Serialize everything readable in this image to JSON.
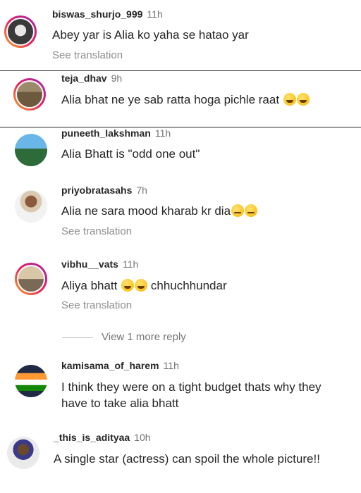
{
  "comments": [
    {
      "username": "biswas_shurjo_999",
      "time": "11h",
      "text": "Abey yar is Alia ko yaha se hatao yar",
      "translate": "See translation"
    },
    {
      "username": "teja_dhav",
      "time": "9h",
      "text": "Alia bhat ne ye sab ratta hoga pichle raat",
      "translate": ""
    },
    {
      "username": "puneeth_lakshman",
      "time": "11h",
      "text": "Alia Bhatt is \"odd one out\"",
      "translate": ""
    },
    {
      "username": "priyobratasahs",
      "time": "7h",
      "text": "Alia ne sara mood kharab kr dia",
      "translate": "See translation"
    },
    {
      "username": "vibhu__vats",
      "time": "11h",
      "text_a": "Aliya bhatt",
      "text_b": "chhuchhundar",
      "translate": "See translation"
    },
    {
      "username": "kamisama_of_harem",
      "time": "11h",
      "text": "I think they were on a tight budget thats why they have to take alia bhatt",
      "translate": ""
    },
    {
      "username": "_this_is_adityaa",
      "time": "10h",
      "text": "A single star (actress) can spoil the whole picture!!",
      "translate": ""
    }
  ],
  "view_more_reply": "View 1 more reply",
  "icons": {
    "emoji_laugh": "grinning-squinting-face-icon",
    "emoji_angry": "confounded-face-icon"
  },
  "colors": {
    "username": "#262626",
    "meta": "#737373",
    "ring_start": "#f9a825",
    "ring_end": "#9c27b0"
  }
}
